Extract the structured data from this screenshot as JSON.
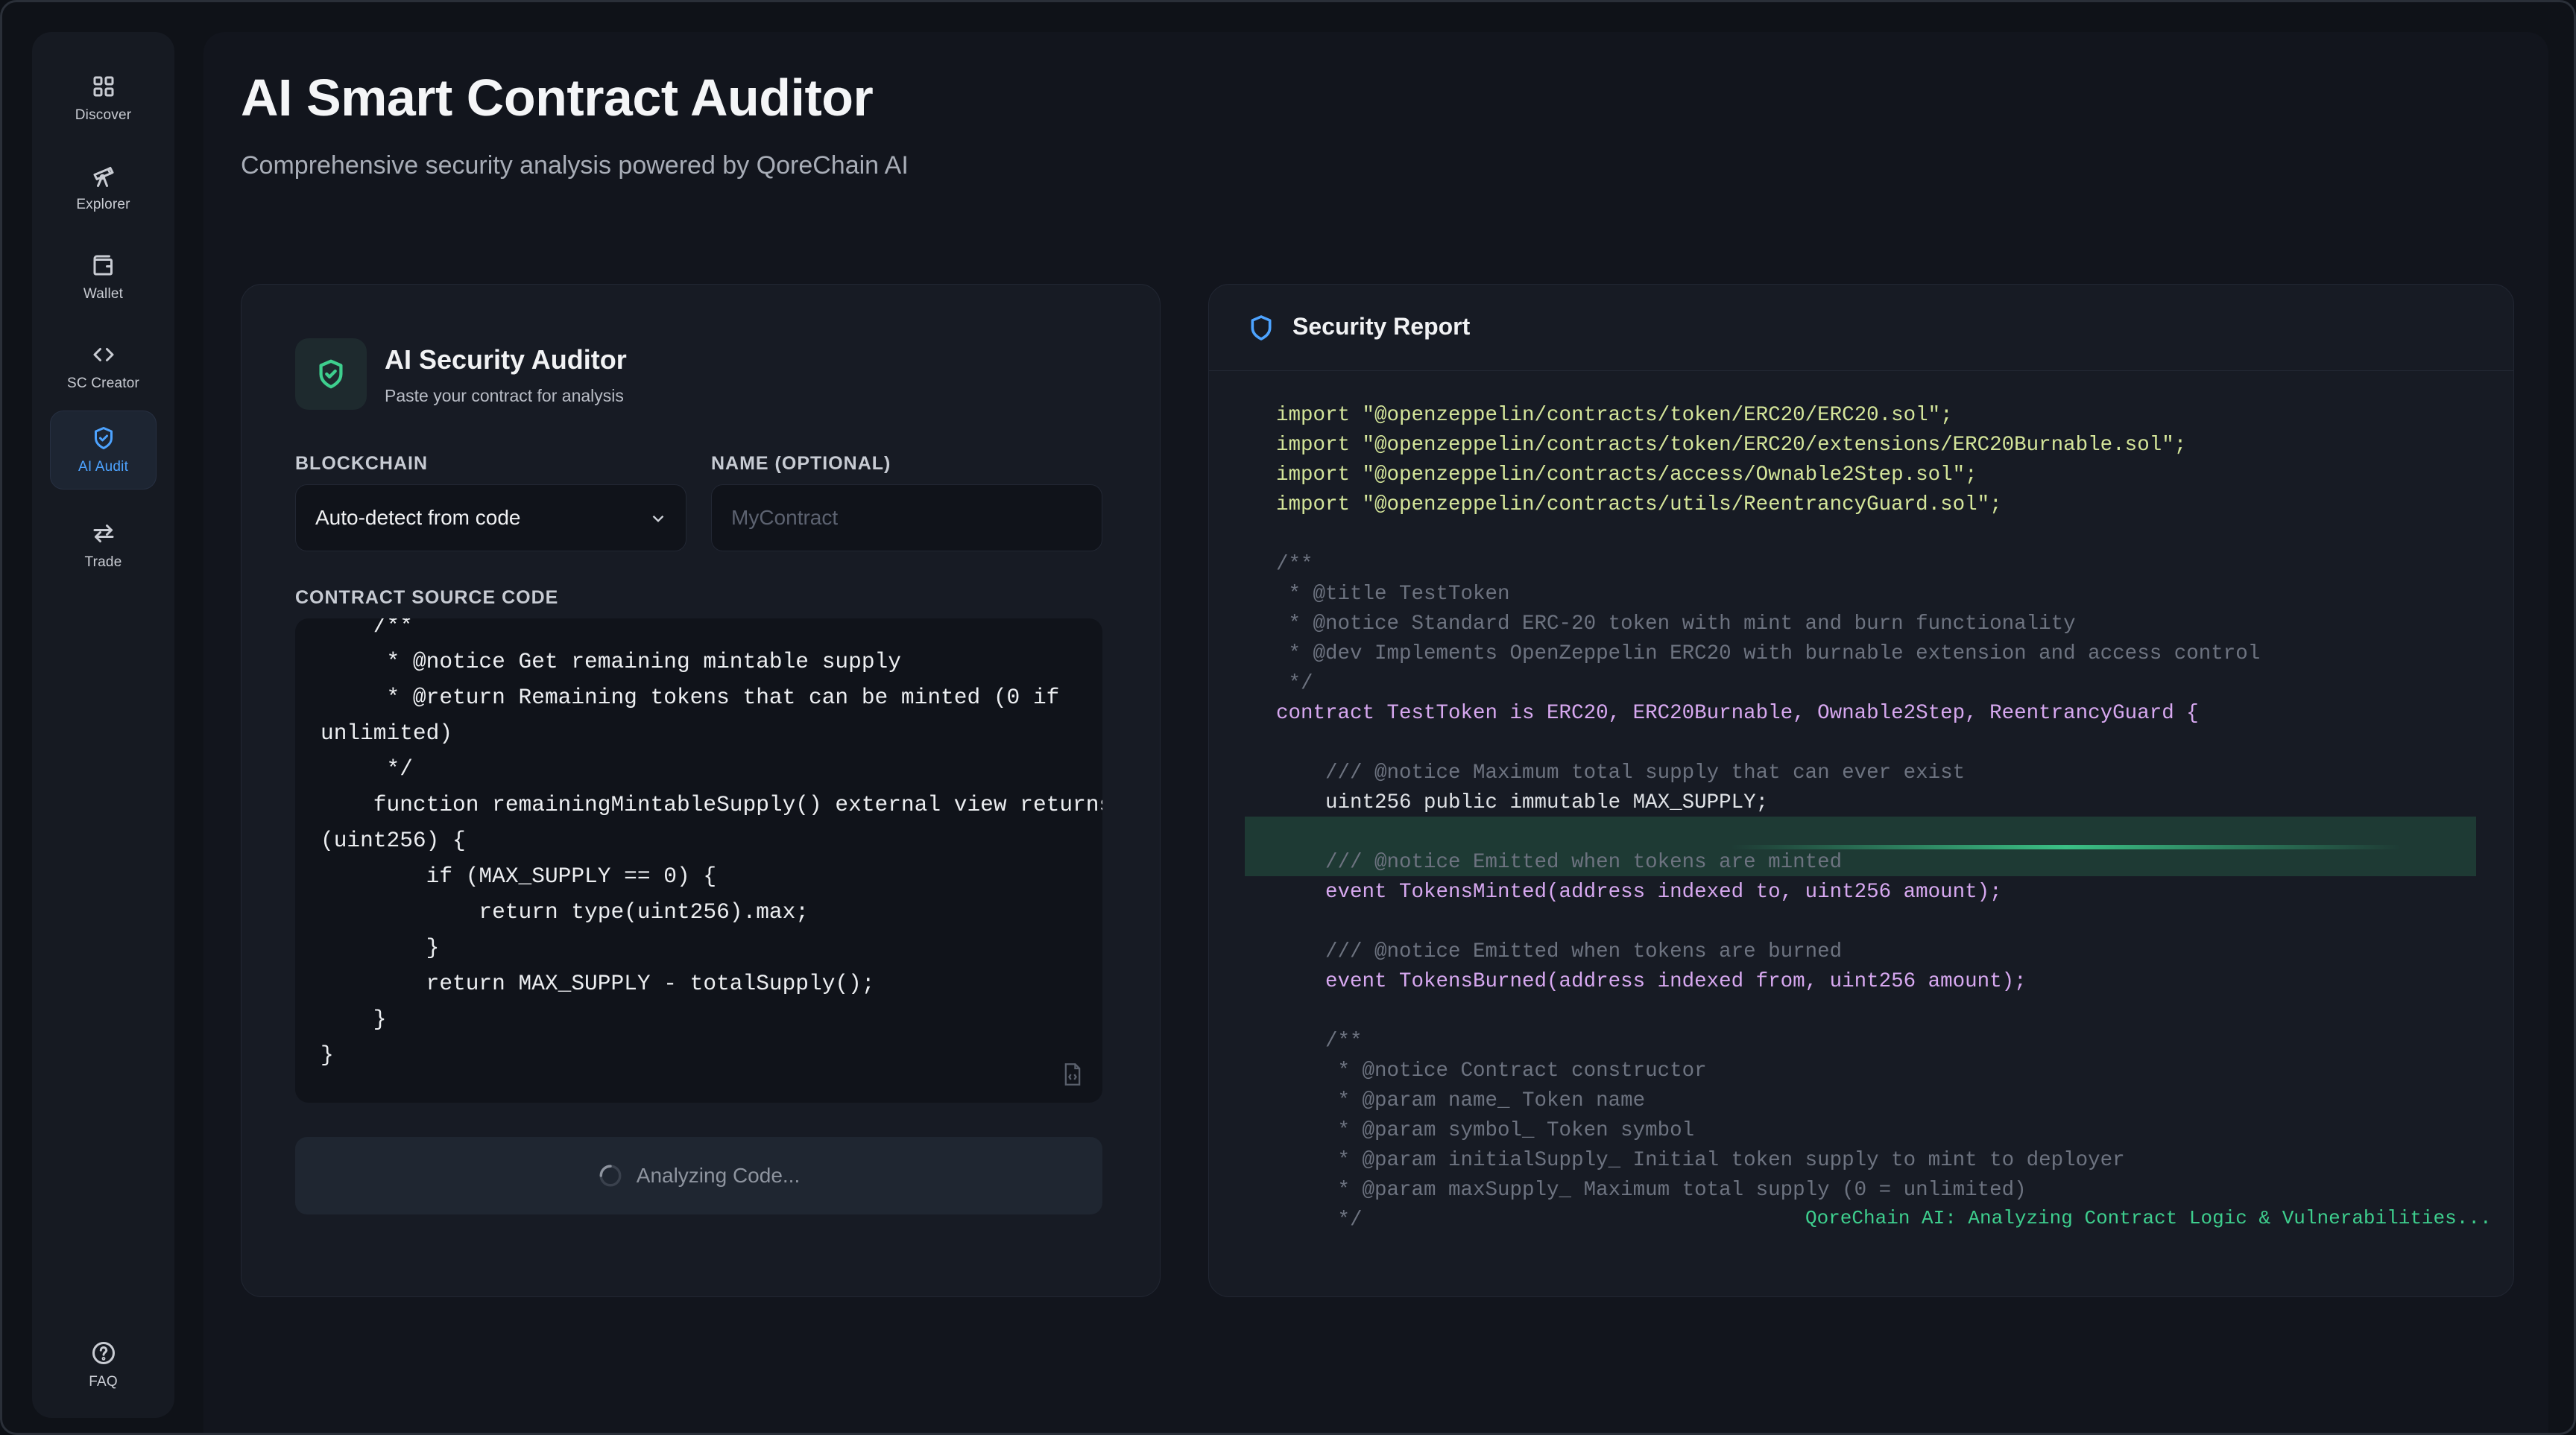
{
  "sidebar": {
    "items": [
      {
        "label": "Discover",
        "icon": "grid-icon"
      },
      {
        "label": "Explorer",
        "icon": "telescope-icon"
      },
      {
        "label": "Wallet",
        "icon": "wallet-icon"
      },
      {
        "label": "SC Creator",
        "icon": "code-icon"
      },
      {
        "label": "AI Audit",
        "icon": "shield-check-icon"
      },
      {
        "label": "Trade",
        "icon": "swap-icon"
      }
    ],
    "faq_label": "FAQ",
    "accent": "#4da3ff"
  },
  "header": {
    "title": "AI Smart Contract Auditor",
    "subtitle": "Comprehensive security analysis powered by QoreChain AI"
  },
  "auditor": {
    "title": "AI Security Auditor",
    "subtitle": "Paste your contract for analysis",
    "blockchain_label": "BLOCKCHAIN",
    "blockchain_value": "Auto-detect from code",
    "name_label": "NAME (OPTIONAL)",
    "name_placeholder": "MyContract",
    "source_label": "CONTRACT SOURCE CODE",
    "source_code": "    /**\n     * @notice Get remaining mintable supply\n     * @return Remaining tokens that can be minted (0 if\nunlimited)\n     */\n    function remainingMintableSupply() external view returns\n(uint256) {\n        if (MAX_SUPPLY == 0) {\n            return type(uint256).max;\n        }\n        return MAX_SUPPLY - totalSupply();\n    }\n}",
    "button_label": "Analyzing Code...",
    "accent": "#3ecf8e"
  },
  "report": {
    "title": "Security Report",
    "lines": [
      {
        "t": "import \"@openzeppelin/contracts/token/ERC20/ERC20.sol\";",
        "k": "import"
      },
      {
        "t": "import \"@openzeppelin/contracts/token/ERC20/extensions/ERC20Burnable.sol\";",
        "k": "import"
      },
      {
        "t": "import \"@openzeppelin/contracts/access/Ownable2Step.sol\";",
        "k": "import"
      },
      {
        "t": "import \"@openzeppelin/contracts/utils/ReentrancyGuard.sol\";",
        "k": "import"
      },
      {
        "t": "",
        "k": "plain"
      },
      {
        "t": "/**",
        "k": "comment"
      },
      {
        "t": " * @title TestToken",
        "k": "comment"
      },
      {
        "t": " * @notice Standard ERC-20 token with mint and burn functionality",
        "k": "comment"
      },
      {
        "t": " * @dev Implements OpenZeppelin ERC20 with burnable extension and access control",
        "k": "comment"
      },
      {
        "t": " */",
        "k": "comment"
      },
      {
        "t": "contract TestToken is ERC20, ERC20Burnable, Ownable2Step, ReentrancyGuard {",
        "k": "kw"
      },
      {
        "t": "",
        "k": "plain"
      },
      {
        "t": "    /// @notice Maximum total supply that can ever exist",
        "k": "comment"
      },
      {
        "t": "    uint256 public immutable MAX_SUPPLY;",
        "k": "plain"
      },
      {
        "t": "",
        "k": "plain"
      },
      {
        "t": "    /// @notice Emitted when tokens are minted",
        "k": "comment"
      },
      {
        "t": "    event TokensMinted(address indexed to, uint256 amount);",
        "k": "kw"
      },
      {
        "t": "",
        "k": "plain"
      },
      {
        "t": "    /// @notice Emitted when tokens are burned",
        "k": "comment"
      },
      {
        "t": "    event TokensBurned(address indexed from, uint256 amount);",
        "k": "kw"
      },
      {
        "t": "",
        "k": "plain"
      },
      {
        "t": "    /**",
        "k": "comment"
      },
      {
        "t": "     * @notice Contract constructor",
        "k": "comment"
      },
      {
        "t": "     * @param name_ Token name",
        "k": "comment"
      },
      {
        "t": "     * @param symbol_ Token symbol",
        "k": "comment"
      },
      {
        "t": "     * @param initialSupply_ Initial token supply to mint to deployer",
        "k": "comment"
      },
      {
        "t": "     * @param maxSupply_ Maximum total supply (0 = unlimited)",
        "k": "comment"
      },
      {
        "t": "     */",
        "k": "comment"
      }
    ],
    "status": "QoreChain AI: Analyzing Contract Logic & Vulnerabilities..."
  }
}
